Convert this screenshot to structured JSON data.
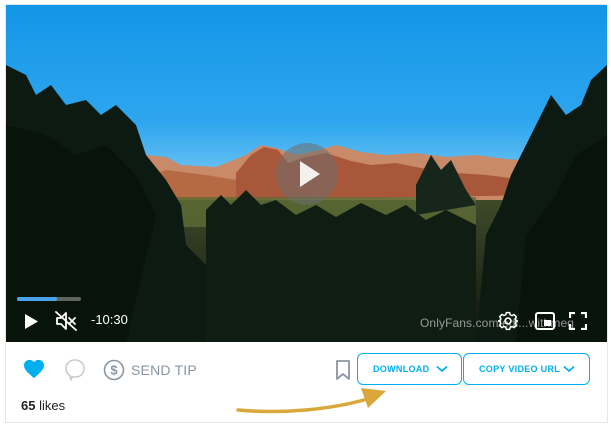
{
  "video": {
    "remaining_time": "-10:30",
    "progress_fraction": 0.05,
    "watermark": "OnlyFans.com/edi...withmeg",
    "progress_color": "#4aa3e8"
  },
  "actions": {
    "send_tip_label": "SEND TIP",
    "download_label": "DOWNLOAD",
    "copy_url_label": "COPY VIDEO URL",
    "likes_count": "65",
    "likes_label": "likes",
    "accent_color": "#00aff0",
    "arrow_color": "#d9a73a"
  },
  "icons": [
    "play-icon",
    "mute-icon",
    "settings-icon",
    "pip-icon",
    "fullscreen-icon",
    "heart-icon",
    "comment-icon",
    "tip-icon",
    "bookmark-icon",
    "chevron-down-icon"
  ]
}
